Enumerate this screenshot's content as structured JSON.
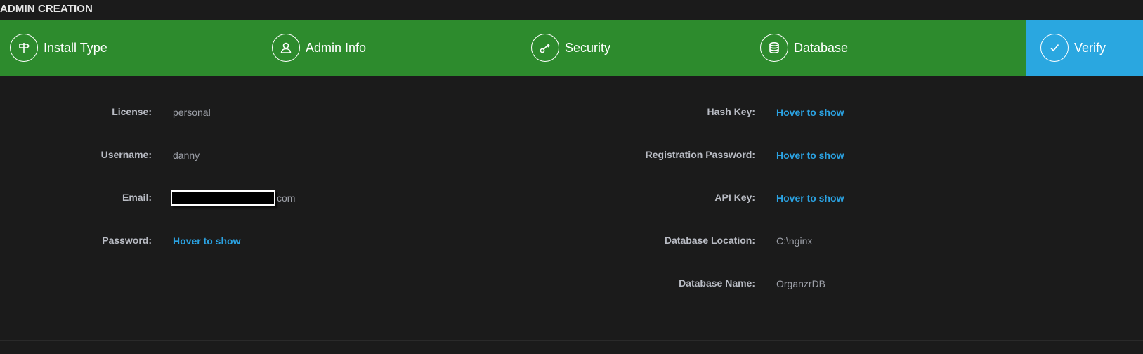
{
  "header": {
    "title": "ADMIN CREATION"
  },
  "wizard": {
    "steps": [
      {
        "label": "Install Type",
        "icon": "signpost-icon"
      },
      {
        "label": "Admin Info",
        "icon": "user-icon"
      },
      {
        "label": "Security",
        "icon": "key-icon"
      },
      {
        "label": "Database",
        "icon": "database-icon"
      },
      {
        "label": "Verify",
        "icon": "check-icon"
      }
    ],
    "colors": {
      "bar": "#2d8b2d",
      "active": "#2aa7e0"
    }
  },
  "left": {
    "license": {
      "label": "License:",
      "value": "personal"
    },
    "username": {
      "label": "Username:",
      "value": "danny"
    },
    "email": {
      "label": "Email:",
      "value_suffix": "com"
    },
    "password": {
      "label": "Password:",
      "value": "Hover to show"
    }
  },
  "right": {
    "hash_key": {
      "label": "Hash Key:",
      "value": "Hover to show"
    },
    "registration_password": {
      "label": "Registration Password:",
      "value": "Hover to show"
    },
    "api_key": {
      "label": "API Key:",
      "value": "Hover to show"
    },
    "database_location": {
      "label": "Database Location:",
      "value": "C:\\nginx"
    },
    "database_name": {
      "label": "Database Name:",
      "value": "OrganzrDB"
    }
  }
}
